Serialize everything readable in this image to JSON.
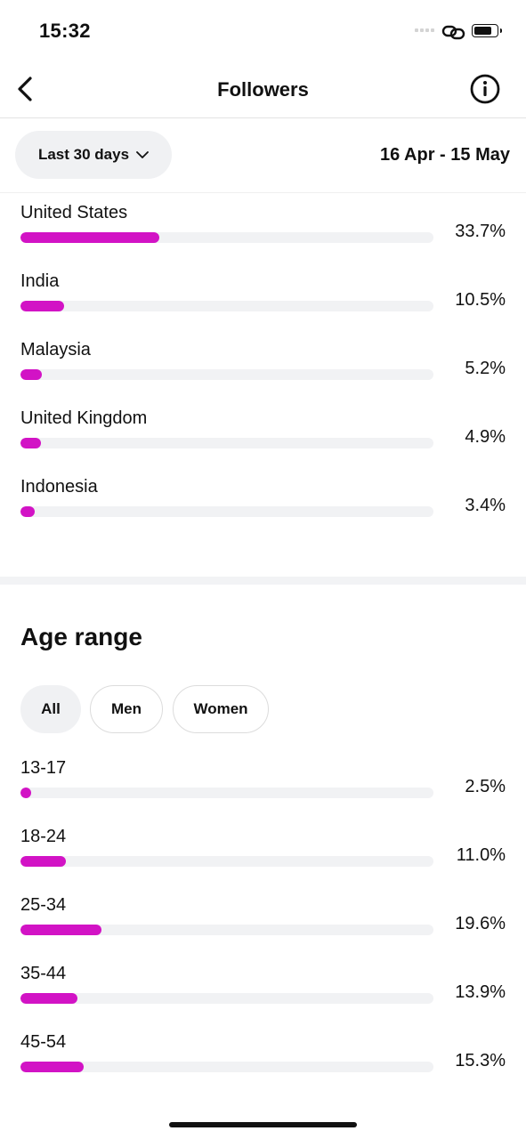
{
  "status_bar": {
    "time": "15:32"
  },
  "nav": {
    "title": "Followers"
  },
  "filter": {
    "period_label": "Last 30 days",
    "date_range": "16 Apr - 15 May"
  },
  "countries": [
    {
      "label": "United States",
      "value": "33.7%",
      "percent": 33.7
    },
    {
      "label": "India",
      "value": "10.5%",
      "percent": 10.5
    },
    {
      "label": "Malaysia",
      "value": "5.2%",
      "percent": 5.2
    },
    {
      "label": "United Kingdom",
      "value": "4.9%",
      "percent": 4.9
    },
    {
      "label": "Indonesia",
      "value": "3.4%",
      "percent": 3.4
    }
  ],
  "age": {
    "title": "Age range",
    "tabs": [
      {
        "label": "All",
        "active": true
      },
      {
        "label": "Men",
        "active": false
      },
      {
        "label": "Women",
        "active": false
      }
    ],
    "ranges": [
      {
        "label": "13-17",
        "value": "2.5%",
        "percent": 2.5
      },
      {
        "label": "18-24",
        "value": "11.0%",
        "percent": 11.0
      },
      {
        "label": "25-34",
        "value": "19.6%",
        "percent": 19.6
      },
      {
        "label": "35-44",
        "value": "13.9%",
        "percent": 13.9
      },
      {
        "label": "45-54",
        "value": "15.3%",
        "percent": 15.3
      }
    ]
  },
  "colors": {
    "bar_fill": "#d213c5",
    "track": "#f1f2f4"
  }
}
